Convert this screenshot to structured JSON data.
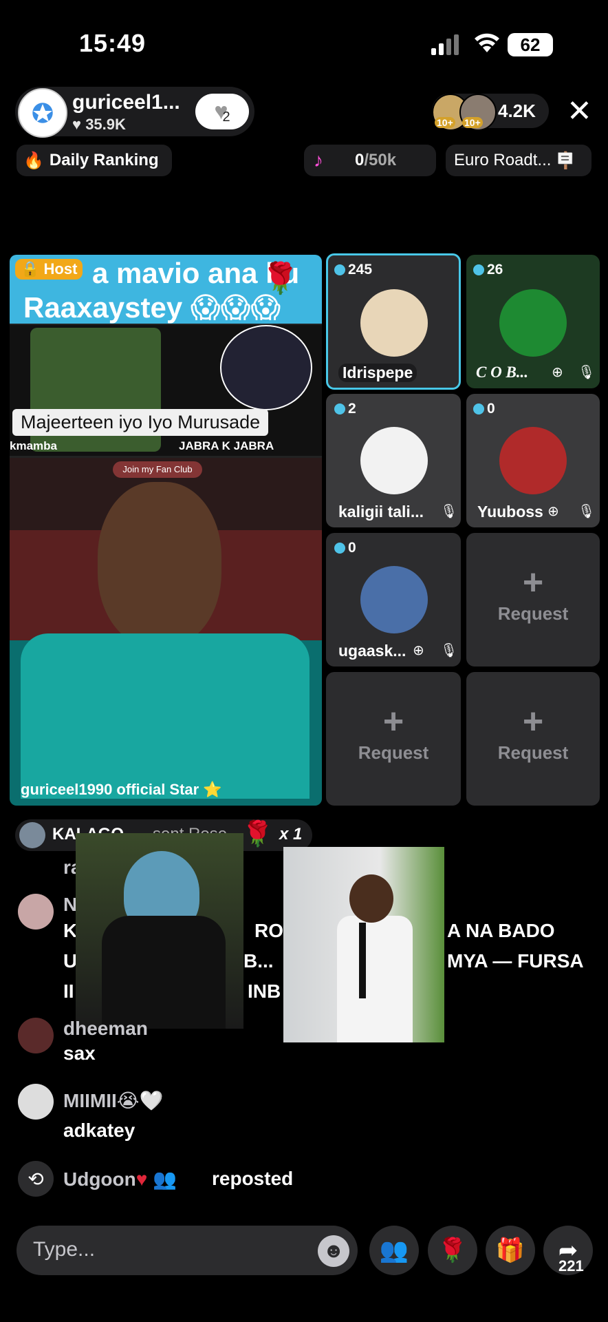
{
  "status_bar": {
    "time": "15:49",
    "battery": "62"
  },
  "host": {
    "name": "guriceel1...",
    "likes": "35.9K",
    "like_count": "2"
  },
  "viewers": {
    "count": "4.2K",
    "badge1": "10+",
    "badge2": "10+"
  },
  "top_row": {
    "daily_ranking": "Daily Ranking",
    "goal_progress": "0",
    "goal_target": "/50k",
    "euro_label": "Euro Roadt..."
  },
  "host_video": {
    "host_tag": "Host",
    "banner_line1": "a mavio ana ku",
    "banner_line2": "Raaxaystey",
    "caption": "Majeerteen iyo Iyo Murusade",
    "left_label": "kmamba",
    "right_label": "JABRA K JABRA",
    "fan_club": "Join my Fan Club",
    "host_label": "guriceel1990 official Star"
  },
  "guests": [
    {
      "count": "245",
      "name": "Idrispepe"
    },
    {
      "count": "26",
      "name": "C O B..."
    },
    {
      "count": "2",
      "name": "kaligii tali..."
    },
    {
      "count": "0",
      "name": "Yuuboss"
    },
    {
      "count": "0",
      "name": "ugaask..."
    }
  ],
  "request_label": "Request",
  "gift_notice": {
    "user": "KALAGO",
    "action": "sent Rose",
    "multiplier": "x 1"
  },
  "chat": [
    {
      "user": "ra",
      "text": ""
    },
    {
      "user": "N",
      "line1": "K",
      "line1b": "ROB",
      "line1c": "A NA BADO",
      "line2": "U",
      "line2b": "B...",
      "line2c": "MYA — FURSA",
      "line3": "II",
      "line3b": "INB"
    },
    {
      "user": "dheeman",
      "text": "sax"
    },
    {
      "user": "MIIMII",
      "text": "adkatey"
    },
    {
      "user": "Udgoon",
      "text": "reposted"
    }
  ],
  "bottom_bar": {
    "placeholder": "Type...",
    "share_count": "221"
  },
  "colors": {
    "accent_cyan": "#48c8e8",
    "host_tag": "#f2a818",
    "tile_bg": "#2c2c2e"
  }
}
